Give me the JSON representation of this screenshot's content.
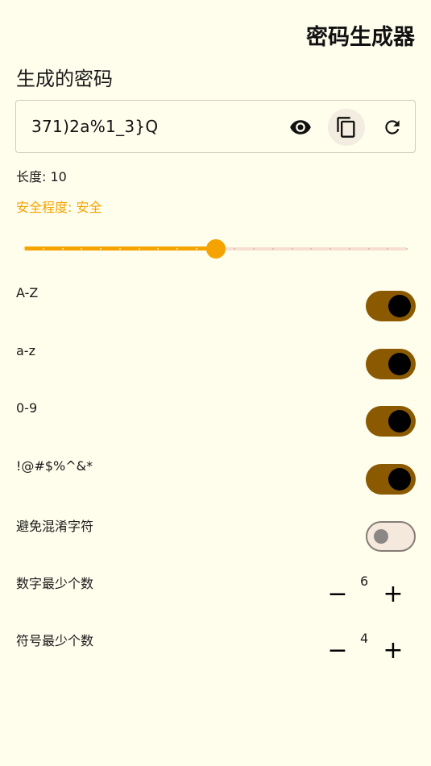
{
  "app": {
    "title": "密码生成器"
  },
  "generated": {
    "section_title": "生成的密码",
    "password": "371)2a%1_3}Q",
    "icons": [
      "eye-icon",
      "copy-icon",
      "refresh-icon"
    ]
  },
  "length": {
    "label": "长度: 10",
    "value": 10,
    "min": 0,
    "max": 20,
    "steps": 20
  },
  "strength": {
    "label": "安全程度: 安全",
    "color": "#F5A300"
  },
  "options": [
    {
      "label": "A-Z",
      "enabled": true
    },
    {
      "label": "a-z",
      "enabled": true
    },
    {
      "label": "0-9",
      "enabled": true
    },
    {
      "label": "!@#$%^&*",
      "enabled": true
    },
    {
      "label": "避免混淆字符",
      "enabled": false
    }
  ],
  "steppers": [
    {
      "label": "数字最少个数",
      "value": "6",
      "minus": "−",
      "plus": "+"
    },
    {
      "label": "符号最少个数",
      "value": "4",
      "minus": "−",
      "plus": "+"
    }
  ],
  "colors": {
    "background": "#FFFDEC",
    "accent": "#F5A300",
    "switch_on": "#8B5A00",
    "switch_off": "#F5E8DC"
  }
}
